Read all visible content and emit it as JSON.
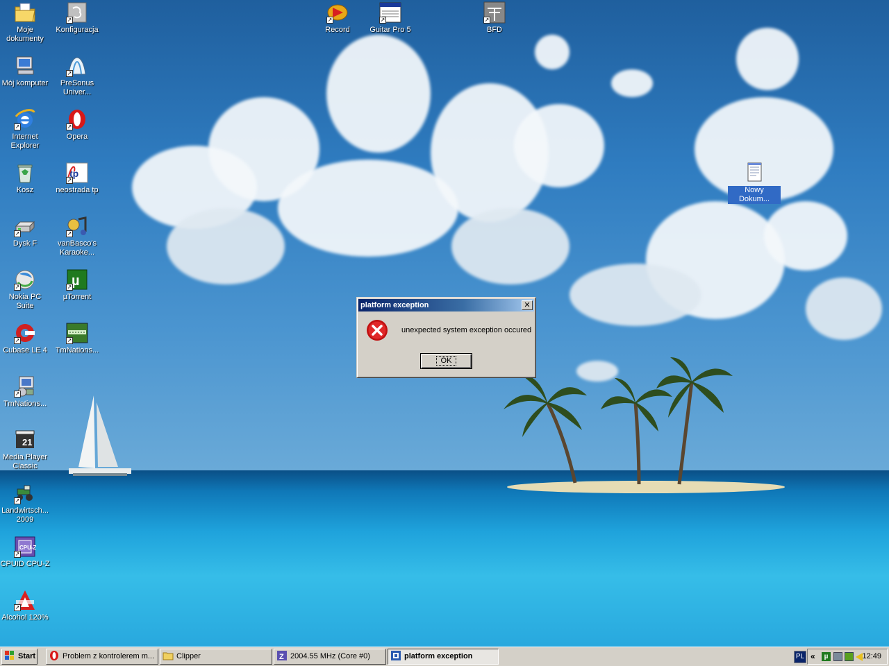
{
  "desktop": {
    "icons": [
      {
        "label": "Moje dokumenty",
        "icon": "my-documents-icon"
      },
      {
        "label": "Konfiguracja",
        "icon": "config-icon"
      },
      {
        "label": "Mój komputer",
        "icon": "my-computer-icon"
      },
      {
        "label": "PreSonus Univer...",
        "icon": "presonus-icon"
      },
      {
        "label": "Internet Explorer",
        "icon": "internet-explorer-icon"
      },
      {
        "label": "Opera",
        "icon": "opera-icon"
      },
      {
        "label": "Kosz",
        "icon": "recycle-bin-icon"
      },
      {
        "label": "neostrada tp",
        "icon": "neostrada-icon"
      },
      {
        "label": "Dysk F",
        "icon": "drive-icon"
      },
      {
        "label": "vanBasco's Karaoke...",
        "icon": "karaoke-icon"
      },
      {
        "label": "Nokia PC Suite",
        "icon": "nokia-icon"
      },
      {
        "label": "µTorrent",
        "icon": "utorrent-icon"
      },
      {
        "label": "Cubase LE 4",
        "icon": "cubase-icon"
      },
      {
        "label": "TmNations...",
        "icon": "tmnations-icon"
      },
      {
        "label": "TmNations...",
        "icon": "tmnations-setup-icon"
      },
      {
        "label": "Media Player Classic",
        "icon": "media-player-icon"
      },
      {
        "label": "Landwirtsch... 2009",
        "icon": "tractor-icon"
      },
      {
        "label": "CPUID CPU-Z",
        "icon": "cpuz-icon"
      },
      {
        "label": "Alcohol 120%",
        "icon": "alcohol-icon"
      },
      {
        "label": "Record",
        "icon": "record-icon"
      },
      {
        "label": "Guitar Pro 5",
        "icon": "guitar-pro-icon"
      },
      {
        "label": "BFD",
        "icon": "bfd-icon"
      },
      {
        "label": "Nowy Dokum...",
        "icon": "text-document-icon"
      }
    ]
  },
  "dialog": {
    "title": "platform exception",
    "message": "unexpected system exception occured",
    "ok_label": "OK",
    "close_glyph": "✕"
  },
  "taskbar": {
    "start_label": "Start",
    "tasks": [
      {
        "label": "Problem z kontrolerem m...",
        "icon": "opera-icon"
      },
      {
        "label": "Clipper",
        "icon": "folder-icon"
      },
      {
        "label": "2004.55 MHz (Core #0)",
        "icon": "cpu-monitor-icon"
      },
      {
        "label": "platform exception",
        "icon": "app-icon"
      }
    ],
    "language": "PL",
    "tray_expand": "«",
    "clock": "12:49"
  },
  "colors": {
    "titlebar_start": "#0a246a",
    "titlebar_end": "#a6caf0",
    "error_red": "#d8201c",
    "window_face": "#d4d0c8"
  }
}
